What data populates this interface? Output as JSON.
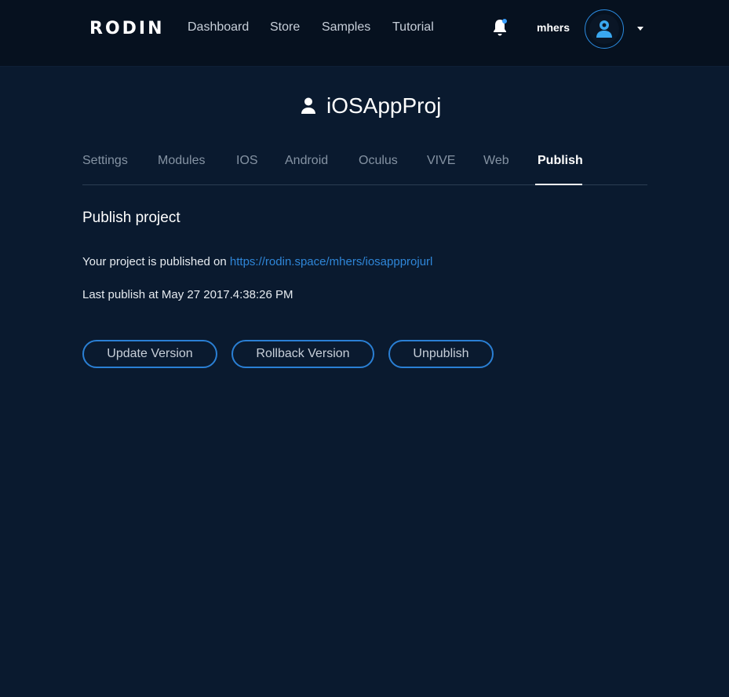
{
  "header": {
    "logo": "RODIN",
    "nav": [
      "Dashboard",
      "Store",
      "Samples",
      "Tutorial"
    ],
    "username": "mhers",
    "icons": {
      "notifications": "bell-icon",
      "avatar": "user-icon",
      "menu": "caret-down-icon"
    },
    "colors": {
      "accent": "#2b8be0",
      "notification_dot": "#3aa0ff"
    }
  },
  "project": {
    "name": "iOSAppProj",
    "icon": "user-icon"
  },
  "tabs": [
    "Settings",
    "Modules",
    "IOS",
    "Android",
    "Oculus",
    "VIVE",
    "Web",
    "Publish"
  ],
  "active_tab": "Publish",
  "publish": {
    "title": "Publish project",
    "published_prefix": "Your project is published on ",
    "url": "https://rodin.space/mhers/iosappprojurl",
    "last_publish": "Last publish at May 27 2017.4:38:26 PM",
    "buttons": {
      "update": "Update Version",
      "rollback": "Rollback Version",
      "unpublish": "Unpublish"
    }
  },
  "colors": {
    "background": "#0a1a2f",
    "header_background": "#06111f",
    "link": "#2f86d8",
    "button_border": "#2a7fd4"
  }
}
